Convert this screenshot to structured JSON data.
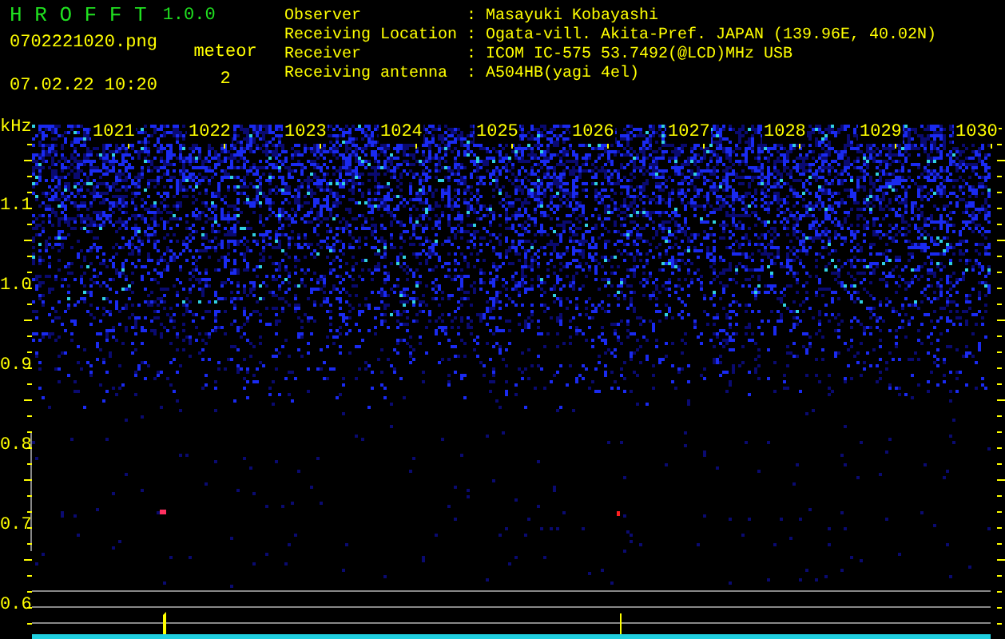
{
  "app": {
    "title": "H R O F F T",
    "version": "1.0.0"
  },
  "file": {
    "name": "0702221020.png",
    "datetime": "07.02.22 10:20"
  },
  "meteor": {
    "label": "meteor",
    "count": "2"
  },
  "station": [
    {
      "label": "Observer",
      "separator": ":",
      "value": "Masayuki Kobayashi"
    },
    {
      "label": "Receiving Location",
      "separator": ":",
      "value": "Ogata-vill. Akita-Pref. JAPAN (139.96E, 40.02N)"
    },
    {
      "label": "Receiver",
      "separator": ":",
      "value": "ICOM IC-575 53.7492(@LCD)MHz USB"
    },
    {
      "label": "Receiving antenna",
      "separator": ":",
      "value": "A504HB(yagi 4el)"
    }
  ],
  "spectrogram": {
    "y_unit": "kHz",
    "x_labels": [
      "1021",
      "1022",
      "1023",
      "1024",
      "1025",
      "1026",
      "1027",
      "1028",
      "1029",
      "1030"
    ],
    "y_labels": [
      "1.1",
      "1.0",
      "0.9",
      "0.8",
      "0.7",
      "0.6"
    ]
  }
}
